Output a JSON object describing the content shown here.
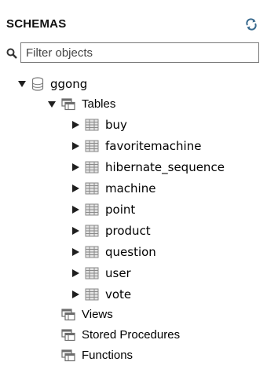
{
  "schemas_panel": {
    "title": "SCHEMAS",
    "refresh_icon": "refresh-icon",
    "filter": {
      "placeholder": "Filter objects",
      "value": ""
    },
    "tree": {
      "schema": {
        "name": "ggong",
        "expanded": true,
        "tables": {
          "label": "Tables",
          "expanded": true,
          "items": [
            "buy",
            "favoritemachine",
            "hibernate_sequence",
            "machine",
            "point",
            "product",
            "question",
            "user",
            "vote"
          ]
        },
        "views": {
          "label": "Views"
        },
        "stored_procedures": {
          "label": "Stored Procedures"
        },
        "functions": {
          "label": "Functions"
        }
      }
    }
  },
  "colors": {
    "arrow": "#1f1f1f",
    "table_icon_fill": "#e4e4e4",
    "table_icon_line": "#8a8a8a",
    "folder_icon": "#6d6d6d",
    "db_icon": "#7a7a7a"
  }
}
